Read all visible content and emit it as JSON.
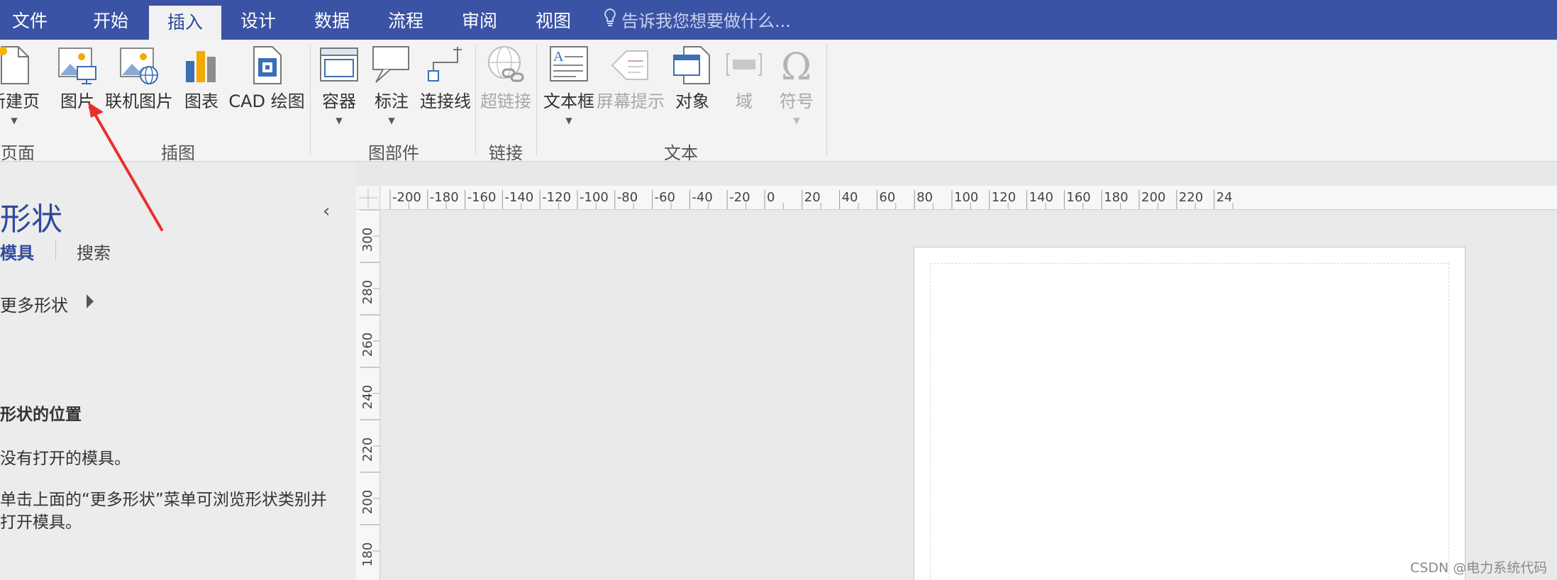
{
  "ribbon": {
    "tabs": [
      "文件",
      "开始",
      "插入",
      "设计",
      "数据",
      "流程",
      "审阅",
      "视图"
    ],
    "active_tab": "插入",
    "tell_me_placeholder": "告诉我您想要做什么...",
    "buttons": {
      "new_page": "新建页",
      "picture": "图片",
      "online_picture": "联机图片",
      "chart": "图表",
      "cad_drawing": "CAD 绘图",
      "container": "容器",
      "callout": "标注",
      "connector": "连接线",
      "hyperlink": "超链接",
      "text_box": "文本框",
      "screen_tip": "屏幕提示",
      "object": "对象",
      "field": "域",
      "symbol": "符号"
    },
    "groups": {
      "pages": "页面",
      "illustrations": "插图",
      "diagram_parts": "图部件",
      "links": "链接",
      "text": "文本"
    },
    "accent_color": "#3b53a5"
  },
  "shapes_pane": {
    "title": "形状",
    "tab_stencils": "模具",
    "tab_search": "搜索",
    "more_shapes": "更多形状",
    "location_heading": "形状的位置",
    "no_stencils": "没有打开的模具。",
    "hint": "单击上面的“更多形状”菜单可浏览形状类别并打开模具。"
  },
  "rulers": {
    "horizontal_ticks": [
      "-200",
      "-180",
      "-160",
      "-140",
      "-120",
      "-100",
      "-80",
      "-60",
      "-40",
      "-20",
      "0",
      "20",
      "40",
      "60",
      "80",
      "100",
      "120",
      "140",
      "160",
      "180",
      "200",
      "220",
      "24"
    ],
    "vertical_ticks": [
      "300",
      "280",
      "260",
      "240",
      "220",
      "200",
      "180"
    ]
  },
  "watermark": "CSDN @电力系统代码"
}
